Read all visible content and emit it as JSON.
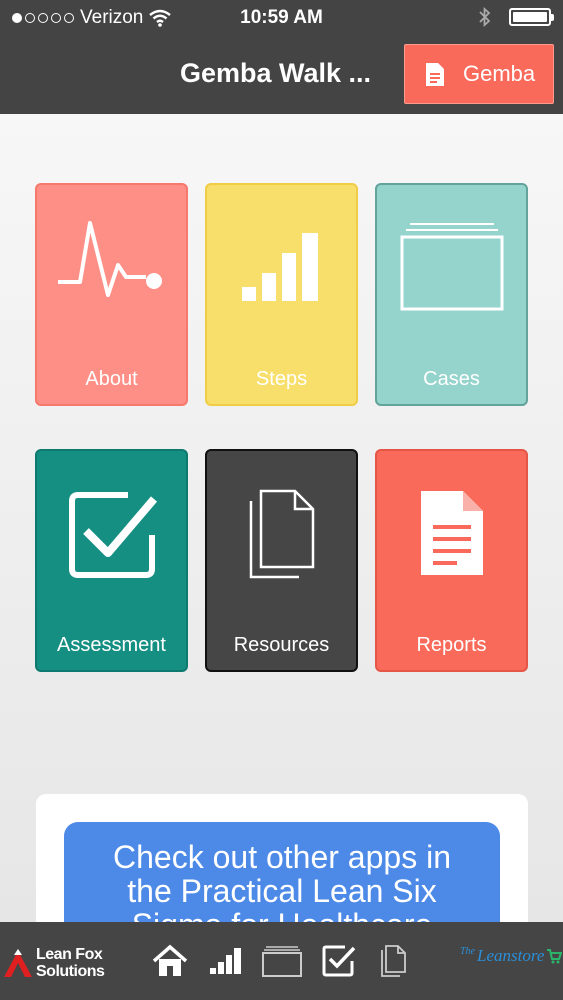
{
  "status_bar": {
    "carrier": "Verizon",
    "time": "10:59 AM"
  },
  "nav": {
    "title": "Gemba Walk ...",
    "action_label": "Gemba"
  },
  "tiles": [
    {
      "label": "About",
      "icon": "pulse-icon",
      "color": "#fd8f86"
    },
    {
      "label": "Steps",
      "icon": "signal-bars-icon",
      "color": "#f8df6b"
    },
    {
      "label": "Cases",
      "icon": "folder-stack-icon",
      "color": "#95d3cd"
    },
    {
      "label": "Assessment",
      "icon": "checkbox-icon",
      "color": "#168f83"
    },
    {
      "label": "Resources",
      "icon": "copy-documents-icon",
      "color": "#464646"
    },
    {
      "label": "Reports",
      "icon": "document-icon",
      "color": "#fa6a5a"
    }
  ],
  "promo": {
    "line1": "Check out other apps in",
    "line2": "the Practical Lean Six",
    "line3": "Sigma for Healthcare"
  },
  "tab_bar": {
    "brand_left_line1": "Lean Fox",
    "brand_left_line2": "Solutions",
    "brand_right_small": "The",
    "brand_right": "Leanstore",
    "tabs": [
      "home-icon",
      "signal-bars-icon",
      "folder-icon",
      "checkbox-icon",
      "copy-documents-icon"
    ]
  },
  "colors": {
    "bar_background": "#444444",
    "accent": "#fa6a5a",
    "promo_blue": "#4d8ae8"
  }
}
